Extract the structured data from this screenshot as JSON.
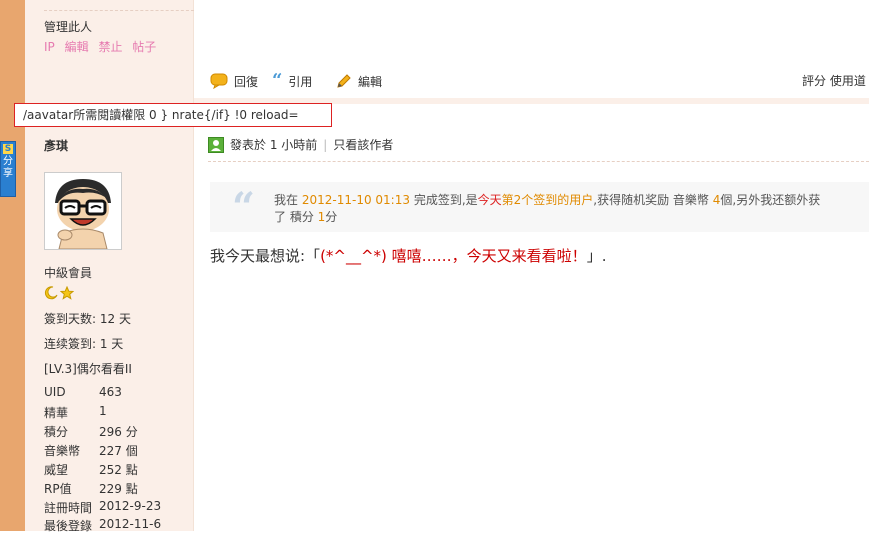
{
  "share_tab": {
    "label": "分享",
    "icon_letter": "S"
  },
  "manage": {
    "title": "管理此人",
    "links": [
      "IP",
      "編輯",
      "禁止",
      "帖子"
    ]
  },
  "annotation": {
    "text": "/aavatar所需閱讀權限 0 } nrate{/if} !0 reload="
  },
  "toolbar": {
    "reply": "回復",
    "quote": "引用",
    "edit": "編輯",
    "right_text": "評分  使用道"
  },
  "user": {
    "name": "彥琪",
    "rank": "中級會員",
    "signin_days": "簽到天数: 12 天",
    "consecutive": "连续簽到: 1 天",
    "level": "[LV.3]偶尔看看II",
    "stats": [
      {
        "k": "UID",
        "v": "463"
      },
      {
        "k": "精華",
        "v": "1"
      },
      {
        "k": "積分",
        "v": "296 分"
      },
      {
        "k": "音樂幣",
        "v": "227 個"
      },
      {
        "k": "威望",
        "v": "252 點"
      },
      {
        "k": "RP值",
        "v": "229 點"
      },
      {
        "k": "註冊時間",
        "v": "2012-9-23"
      },
      {
        "k": "最後登錄",
        "v": "2012-11-6"
      }
    ]
  },
  "post_meta": {
    "posted": "發表於 1 小時前",
    "separator": "|",
    "author_only": "只看該作者"
  },
  "quote_box": {
    "prefix": "我在",
    "datetime": "2012-11-10 01:13",
    "mid1": "完成签到,是",
    "today": "今天",
    "rank_text": "第2个签到的用户",
    "mid2": ",获得随机奖励 音樂幣",
    "coins": "4",
    "mid3": "個,另外我还额外获",
    "line2_prefix": "了 積分",
    "points": "1",
    "line2_suffix": "分"
  },
  "message": {
    "prefix": "我今天最想说:「",
    "emph": "(*^__^*) 嘻嘻……，今天又来看看啦！",
    "suffix": "」."
  },
  "colors": {
    "sidebar": "#fbefe8",
    "left_bar": "#e8a66e",
    "link_pink": "#e67bb0",
    "accent_orange": "#e08a00",
    "accent_red": "#d22"
  }
}
